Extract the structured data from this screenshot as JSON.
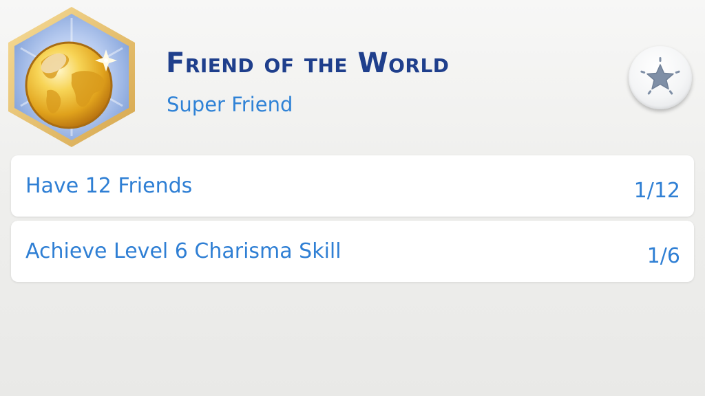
{
  "aspiration": {
    "title": "Friend of the World",
    "subtitle": "Super Friend",
    "badge_icon": "golden-globe-icon",
    "action_icon": "star-icon"
  },
  "goals": [
    {
      "label": "Have 12 Friends",
      "progress_text": "1/12",
      "current": 1,
      "target": 12
    },
    {
      "label": "Achieve Level 6 Charisma Skill",
      "progress_text": "1/6",
      "current": 1,
      "target": 6
    }
  ],
  "colors": {
    "title": "#1f3f8c",
    "accent": "#2f82d6",
    "badge_border": "#e8c06a",
    "badge_inner": "#9fb8e6",
    "globe": "#f2c23a"
  }
}
